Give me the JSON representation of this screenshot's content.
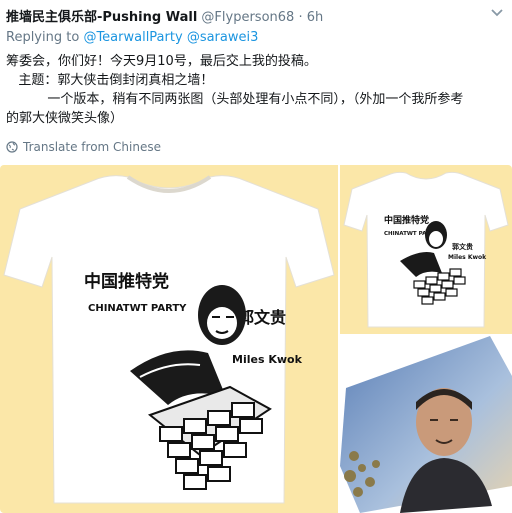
{
  "tweet": {
    "display_name": "推墙民主俱乐部-Pushing Wall",
    "handle": "@Flyperson68",
    "separator": "·",
    "time": "6h",
    "replying_to_label": "Replying to",
    "reply_handles": [
      "@TearwallParty",
      "@sarawei3"
    ],
    "body_lines": [
      "筹委会，你们好！今天9月10号，最后交上我的投稿。",
      "   主题：郭大侠击倒封闭真相之墙！",
      "          一个版本，稍有不同两张图（头部处理有小点不同），（外加一个我所参考",
      "的郭大侠微笑头像）"
    ],
    "translate_label": "Translate from Chinese"
  },
  "shirt_text": {
    "party_cn": "中国推特党",
    "party_en": "CHINATWT   PARTY",
    "name_cn": "郭文贵",
    "name_en": "Miles Kwok"
  },
  "colors": {
    "link": "#1b95e0",
    "muted": "#657786",
    "panel_bg": "#fbe7a8"
  }
}
